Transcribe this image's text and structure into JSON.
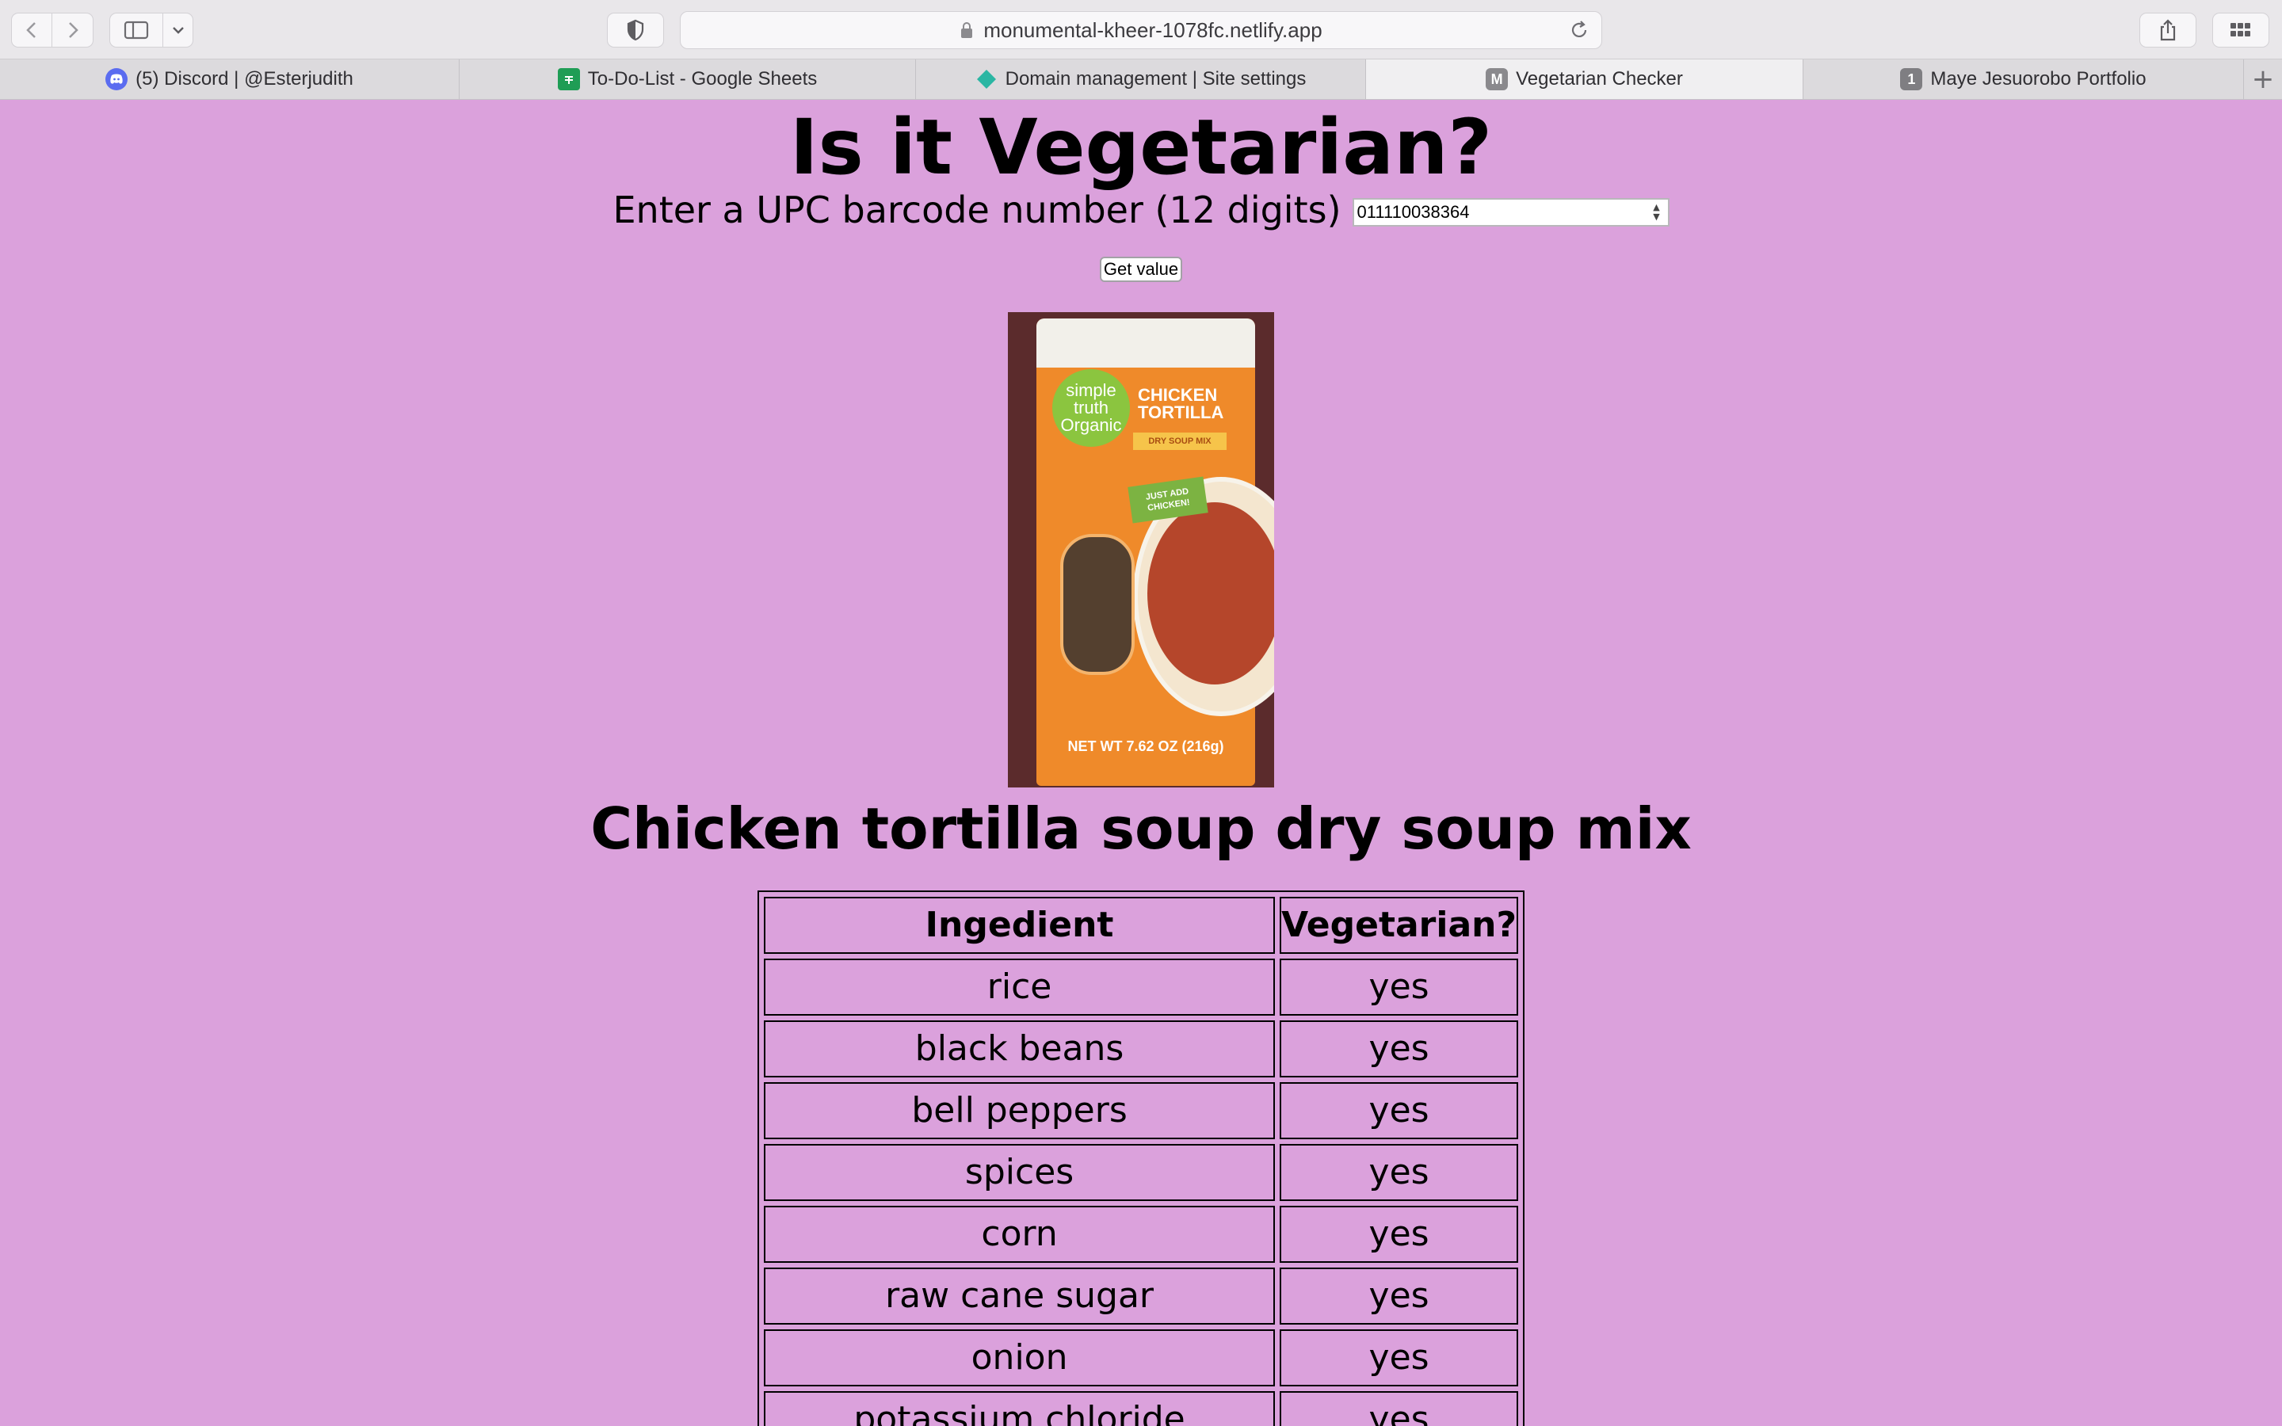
{
  "browser": {
    "url": "monumental-kheer-1078fc.netlify.app",
    "tabs": [
      {
        "label": "(5) Discord | @Esterjudith",
        "icon": "discord-icon"
      },
      {
        "label": "To-Do-List - Google Sheets",
        "icon": "sheets-icon"
      },
      {
        "label": "Domain management | Site settings",
        "icon": "netlify-diamond-icon"
      },
      {
        "label": "Vegetarian Checker",
        "icon_text": "M",
        "icon": "m-favicon",
        "active": true
      },
      {
        "label": "Maye Jesuorobo Portfolio",
        "icon_text": "1",
        "icon": "one-favicon"
      }
    ]
  },
  "page": {
    "title": "Is it Vegetarian?",
    "upc_label": "Enter a UPC barcode number (12 digits)",
    "upc_value": "011110038364",
    "get_button": "Get value",
    "product_name": "Chicken tortilla soup dry soup mix",
    "product_image": {
      "logo_text": "simple truth Organic",
      "title_text": "CHICKEN TORTILLA",
      "badge_text": "DRY SOUP MIX",
      "tag_text": "JUST ADD CHICKEN!",
      "weight_text": "NET WT 7.62 OZ (216g)"
    },
    "table": {
      "headers": [
        "Ingedient",
        "Vegetarian?"
      ],
      "rows": [
        [
          "rice",
          "yes"
        ],
        [
          "black beans",
          "yes"
        ],
        [
          "bell peppers",
          "yes"
        ],
        [
          "spices",
          "yes"
        ],
        [
          "corn",
          "yes"
        ],
        [
          "raw cane sugar",
          "yes"
        ],
        [
          "onion",
          "yes"
        ],
        [
          "potassium chloride",
          "yes"
        ]
      ]
    }
  },
  "colors": {
    "page_background": "#dba1dc",
    "chrome_background": "#e9e7ea"
  }
}
